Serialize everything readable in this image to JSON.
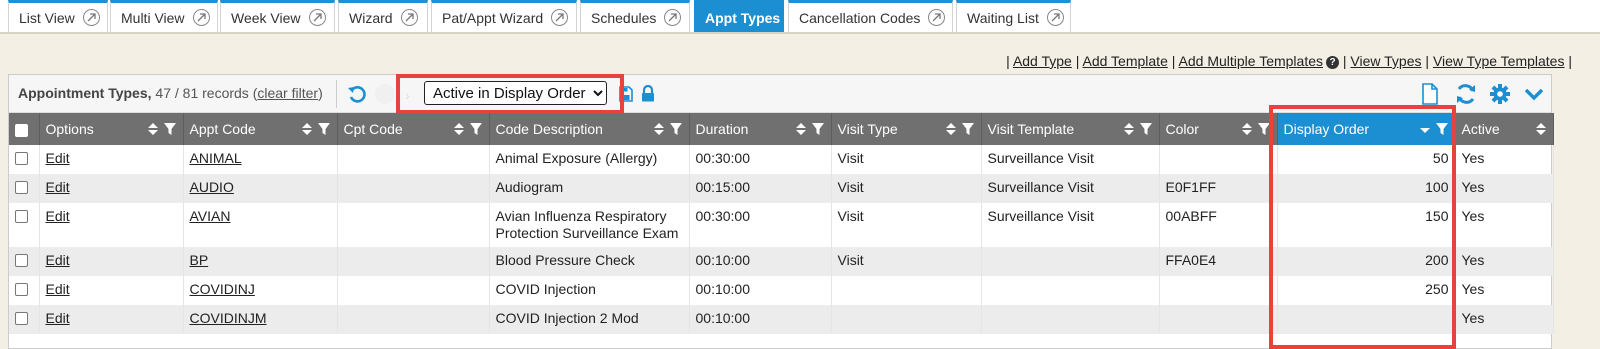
{
  "tabs": [
    {
      "label": "List View",
      "active": false
    },
    {
      "label": "Multi View",
      "active": false
    },
    {
      "label": "Week View",
      "active": false
    },
    {
      "label": "Wizard",
      "active": false
    },
    {
      "label": "Pat/Appt Wizard",
      "active": false
    },
    {
      "label": "Schedules",
      "active": false
    },
    {
      "label": "Appt Types",
      "active": true
    },
    {
      "label": "Cancellation Codes",
      "active": false
    },
    {
      "label": "Waiting List",
      "active": false
    }
  ],
  "links": {
    "add_type": "Add Type",
    "add_template": "Add Template",
    "add_multiple_templates": "Add Multiple Templates",
    "view_types": "View Types",
    "view_type_templates": "View Type Templates"
  },
  "panel": {
    "title": "Appointment Types,",
    "records": "47 / 81 records",
    "clear_filter": "clear filter",
    "view_select": "Active in Display Order"
  },
  "table": {
    "headers": [
      "Options",
      "Appt Code",
      "Cpt Code",
      "Code Description",
      "Duration",
      "Visit Type",
      "Visit Template",
      "Color",
      "Display Order",
      "Active"
    ],
    "rows": [
      {
        "option": "Edit",
        "code": "ANIMAL",
        "cpt": "",
        "desc": "Animal Exposure (Allergy)",
        "duration": "00:30:00",
        "visit_type": "Visit",
        "template": "Surveillance Visit",
        "color": "",
        "order": "50",
        "active": "Yes"
      },
      {
        "option": "Edit",
        "code": "AUDIO",
        "cpt": "",
        "desc": "Audiogram",
        "duration": "00:15:00",
        "visit_type": "Visit",
        "template": "Surveillance Visit",
        "color": "E0F1FF",
        "order": "100",
        "active": "Yes"
      },
      {
        "option": "Edit",
        "code": "AVIAN",
        "cpt": "",
        "desc": "Avian Influenza Respiratory Protection Surveillance Exam",
        "duration": "00:30:00",
        "visit_type": "Visit",
        "template": "Surveillance Visit",
        "color": "00ABFF",
        "order": "150",
        "active": "Yes"
      },
      {
        "option": "Edit",
        "code": "BP",
        "cpt": "",
        "desc": "Blood Pressure Check",
        "duration": "00:10:00",
        "visit_type": "Visit",
        "template": "",
        "color": "FFA0E4",
        "order": "200",
        "active": "Yes"
      },
      {
        "option": "Edit",
        "code": "COVIDINJ",
        "cpt": "",
        "desc": "COVID Injection",
        "duration": "00:10:00",
        "visit_type": "",
        "template": "",
        "color": "",
        "order": "250",
        "active": "Yes"
      },
      {
        "option": "Edit",
        "code": "COVIDINJM",
        "cpt": "",
        "desc": "COVID Injection 2 Mod",
        "duration": "00:10:00",
        "visit_type": "",
        "template": "",
        "color": "",
        "order": "",
        "active": "Yes"
      }
    ]
  },
  "colors": {
    "accent": "#1c8fd2",
    "header": "#707070",
    "highlight": "#e8423f"
  }
}
